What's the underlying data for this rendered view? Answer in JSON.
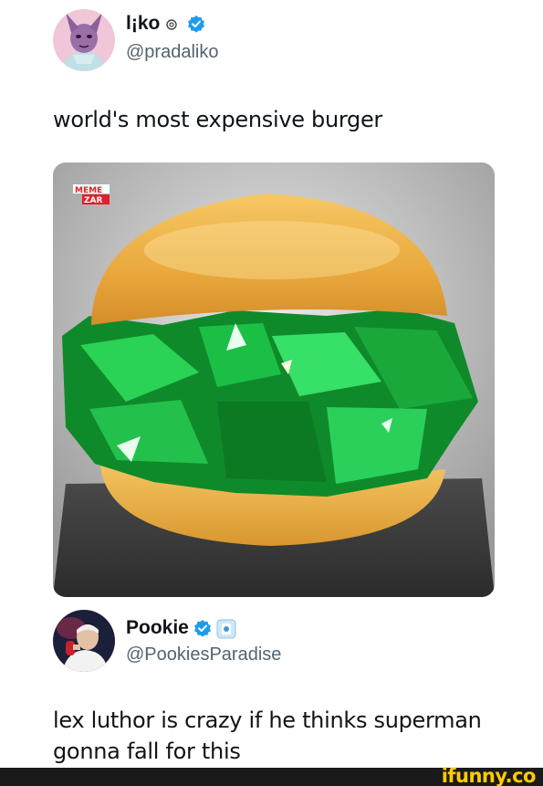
{
  "post1": {
    "display_name": "l¡ko",
    "handle": "@pradaliko",
    "text": "world's most expensive burger",
    "media_alt_icon": "burger-image",
    "watermark_text": [
      "MEME",
      "ZAR"
    ]
  },
  "post2": {
    "display_name": "Pookie",
    "handle": "@PookiesParadise",
    "text": "lex luthor is crazy if he thinks superman gonna fall for this"
  },
  "footer": {
    "brand": "ifunny.co"
  },
  "colors": {
    "verified": "#1d9bf0",
    "emerald": "#19a83a",
    "bun": "#e8b04a",
    "ifunny_yellow": "#ffcc00"
  }
}
